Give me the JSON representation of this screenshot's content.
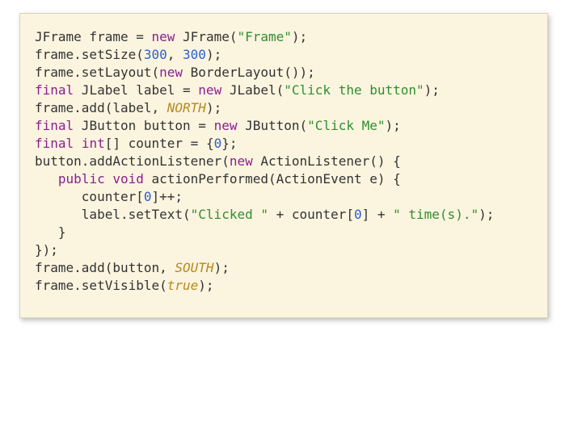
{
  "code": {
    "l1": {
      "a": "JFrame frame = ",
      "b": "new",
      "c": " JFrame(",
      "d": "\"Frame\"",
      "e": ");"
    },
    "l2": {
      "a": "frame.setSize(",
      "b": "300",
      "c": ", ",
      "d": "300",
      "e": ");"
    },
    "l3": {
      "a": "frame.setLayout(",
      "b": "new",
      "c": " BorderLayout());"
    },
    "l4": {
      "a": "final",
      "b": " JLabel label = ",
      "c": "new",
      "d": " JLabel(",
      "e": "\"Click the button\"",
      "f": ");"
    },
    "l5": {
      "a": "frame.add(label, ",
      "b": "NORTH",
      "c": ");"
    },
    "l6": {
      "a": "final",
      "b": " JButton button = ",
      "c": "new",
      "d": " JButton(",
      "e": "\"Click Me\"",
      "f": ");"
    },
    "l7": {
      "a": "final",
      "b": " ",
      "c": "int",
      "d": "[] counter = {",
      "e": "0",
      "f": "};"
    },
    "l8": {
      "a": "button.addActionListener(",
      "b": "new",
      "c": " ActionListener() {"
    },
    "l9": {
      "a": "   ",
      "b": "public",
      "c": " ",
      "d": "void",
      "e": " actionPerformed(ActionEvent e) {"
    },
    "l10": {
      "a": "      counter[",
      "b": "0",
      "c": "]++; "
    },
    "l11": {
      "a": "      label.setText(",
      "b": "\"Clicked \"",
      "c": " + counter[",
      "d": "0",
      "e": "] + ",
      "f": "\" time(s).\"",
      "g": ");"
    },
    "l12": {
      "a": "   }"
    },
    "l13": {
      "a": "});"
    },
    "l14": {
      "a": "frame.add(button, ",
      "b": "SOUTH",
      "c": ");"
    },
    "l15": {
      "a": "frame.setVisible(",
      "b": "true",
      "c": ");"
    }
  }
}
